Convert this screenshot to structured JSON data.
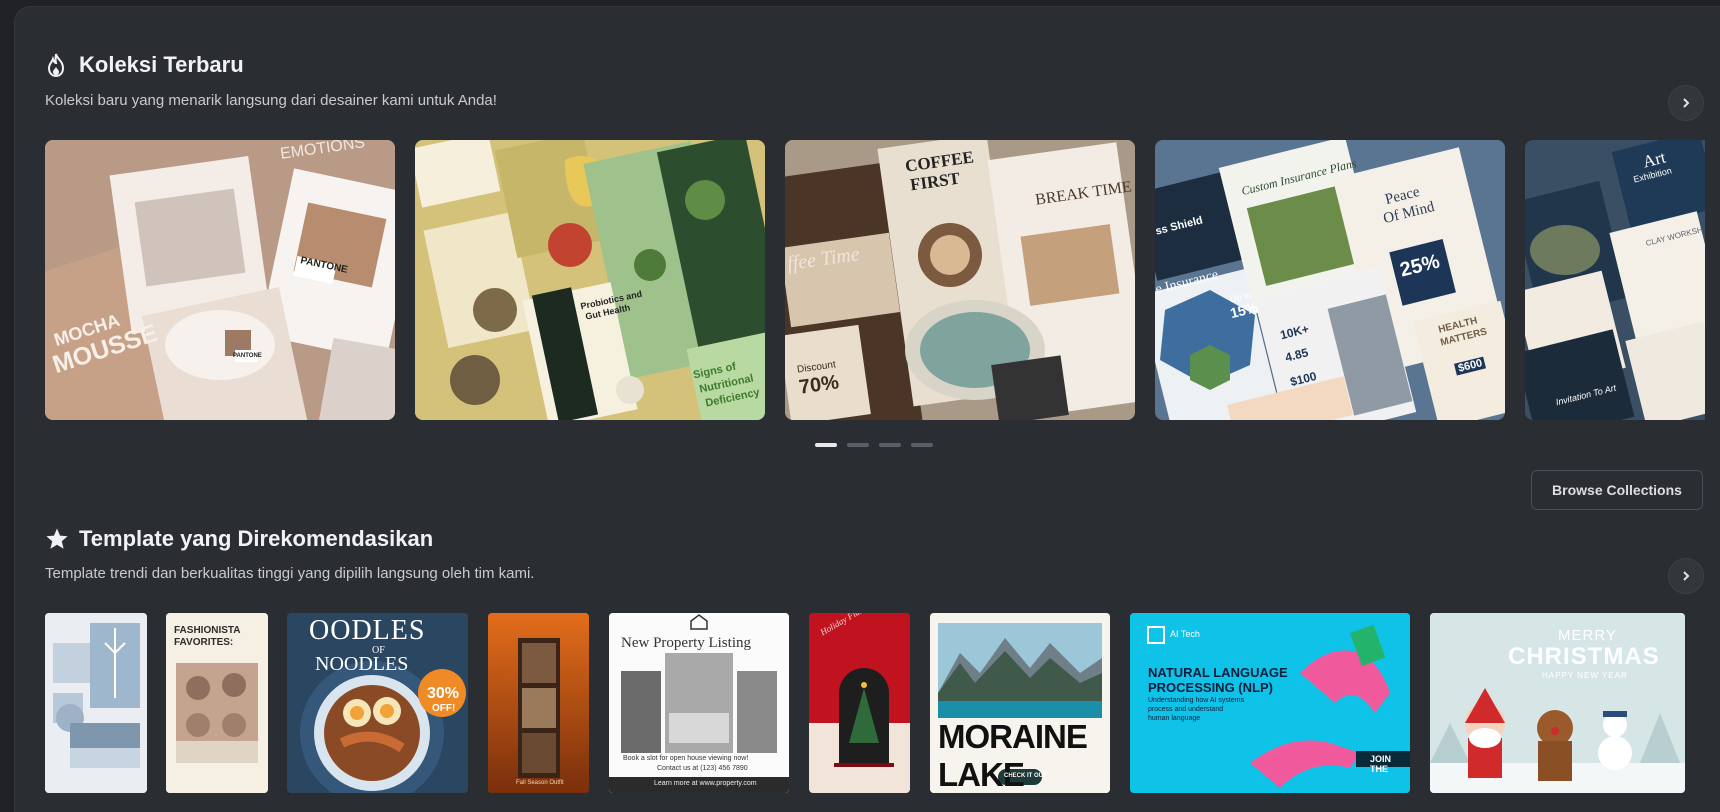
{
  "sections": {
    "new_collections": {
      "title": "Koleksi Terbaru",
      "subtitle": "Koleksi baru yang menarik langsung dari desainer kami untuk Anda!",
      "icon": "flame-icon",
      "cards": [
        {
          "theme": "mocha-mousse",
          "texts": [
            "MOCHA",
            "MOUSSE",
            "PANTONE",
            "PANTONE",
            "EMOTIONS"
          ]
        },
        {
          "theme": "plant-nutrition",
          "texts": [
            "Signs of",
            "Nutritional",
            "Deficiency",
            "Probiotics and",
            "Gut Health"
          ]
        },
        {
          "theme": "coffee-time",
          "texts": [
            "COFFEE",
            "FIRST",
            "BREAK TIME",
            "ffee Time",
            "Discount",
            "70%"
          ]
        },
        {
          "theme": "insurance",
          "texts": [
            "Custom Insurance Plans",
            "Peace",
            "Of Mind",
            "25%",
            "10K+",
            "4.85",
            "$100",
            "HEALTH",
            "MATTERS",
            "$600",
            "ss Shield",
            "e Insurance",
            "Up to",
            "15%"
          ]
        },
        {
          "theme": "art-exhibition",
          "texts": [
            "Art",
            "Exhibition",
            "CLAY WORKSH",
            "Invitation To Art"
          ]
        }
      ],
      "pagination": {
        "count": 4,
        "active": 0
      }
    },
    "browse_button": "Browse Collections",
    "recommended": {
      "title": "Template yang Direkomendasikan",
      "subtitle": "Template trendi dan berkualitas tinggi yang dipilih langsung oleh tim kami.",
      "icon": "star-icon",
      "templates": [
        {
          "theme": "winter-moodboard",
          "texts": []
        },
        {
          "theme": "fashionista",
          "texts": [
            "FASHIONISTA",
            "FAVORITES:"
          ]
        },
        {
          "theme": "noodles",
          "texts": [
            "OODLES",
            "OF",
            "NOODLES",
            "30%",
            "OFF!"
          ]
        },
        {
          "theme": "fall-outfit",
          "texts": [
            "Fall Season Outfit"
          ]
        },
        {
          "theme": "property",
          "texts": [
            "New Property Listing",
            "Book a slot for open house viewing now!",
            "Contact us at (123) 456 7890",
            "Learn more at www.property.com"
          ]
        },
        {
          "theme": "holiday-flash-sale",
          "texts": [
            "Holiday Flash Sale"
          ]
        },
        {
          "theme": "moraine-lake",
          "texts": [
            "MORAINE LAKE",
            "CHECK IT OUT"
          ]
        },
        {
          "theme": "nlp",
          "texts": [
            "AI Tech",
            "NATURAL LANGUAGE",
            "PROCESSING (NLP)",
            "Understanding how AI systems",
            "process and understand",
            "human language",
            "JOIN THE"
          ]
        },
        {
          "theme": "christmas",
          "texts": [
            "MERRY",
            "CHRISTMAS",
            "HAPPY NEW YEAR"
          ]
        }
      ]
    }
  },
  "colors": {
    "background": "#1f2125",
    "panel": "#2a2d32",
    "text": "#f1f2f3",
    "muted": "#c8cace"
  }
}
